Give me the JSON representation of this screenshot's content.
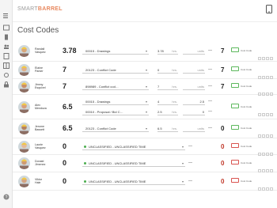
{
  "header": {
    "logo_prefix": "SMART",
    "logo_suffix": "BARREL"
  },
  "page": {
    "title": "Cost Codes"
  },
  "labels": {
    "hrs_unit": "hrs.",
    "units_placeholder": "units",
    "minus": "—",
    "cost_code": "Cost Code"
  },
  "rows": [
    {
      "name": "Randall\nVasquez",
      "total": "3.78",
      "right_total": "7",
      "lines": [
        {
          "code": "00015 - Drawings",
          "hrs": "3.78"
        }
      ]
    },
    {
      "name": "Elaine\nParker",
      "total": "7",
      "right_total": "7",
      "lines": [
        {
          "code": "20123 - Conflict Code",
          "hrs": "0"
        }
      ]
    },
    {
      "name": "Jimmy\nEsquivel",
      "total": "7",
      "right_total": "7",
      "lines": [
        {
          "code": "898989 - Conflict cod…",
          "hrs": "7"
        }
      ]
    },
    {
      "name": "Alex\nMendoza",
      "total": "6.5",
      "right_total": "",
      "lines": [
        {
          "code": "00015 - Drawings",
          "hrs": "4",
          "units": "2.5"
        },
        {
          "code": "00010 - Proposal / Bid C…",
          "hrs": "2.5",
          "units": "0"
        }
      ]
    },
    {
      "name": "Jerome\nBassett",
      "total": "6.5",
      "right_total": "0",
      "lines": [
        {
          "code": "20123 - Conflict Code",
          "hrs": "6.5"
        }
      ]
    },
    {
      "name": "Laurie\nVasquez",
      "total": "0",
      "right_total": "0",
      "unclassified": "UNCLASSIFIED - UNCLASSIFIED TIME"
    },
    {
      "name": "Donald\nJimenez",
      "total": "0",
      "right_total": "0",
      "unclassified": "UNCLASSIFIED - UNCLASSIFIED TIME"
    },
    {
      "name": "Viktor\nHale",
      "total": "0",
      "right_total": "0",
      "unclassified": "UNCLASSIFIED - UNCLASSIFIED TIME"
    }
  ],
  "colors": {
    "accent": "#e8875d",
    "green": "#5cb85c",
    "red": "#d9534f"
  }
}
